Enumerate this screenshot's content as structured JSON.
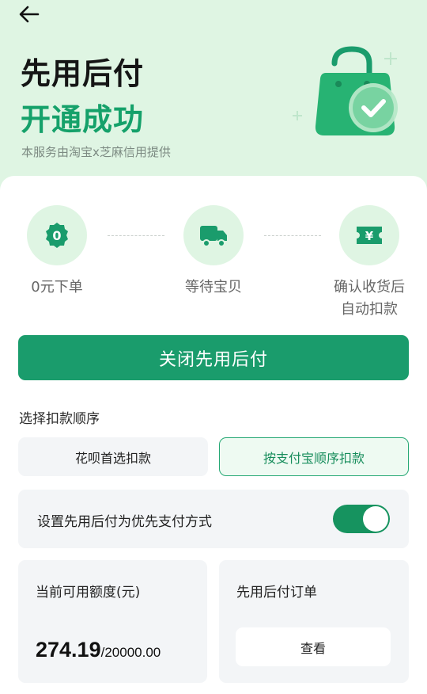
{
  "header": {
    "back_icon": "arrow-left-icon",
    "title": "先用后付",
    "subtitle": "开通成功",
    "note": "本服务由淘宝x芝麻信用提供",
    "illustration_icon": "shopping-bag-check-icon"
  },
  "steps": [
    {
      "icon": "zero-badge-icon",
      "icon_text": "0",
      "label": "0元下单"
    },
    {
      "icon": "truck-icon",
      "label": "等待宝贝"
    },
    {
      "icon": "yuan-ticket-icon",
      "icon_text": "¥",
      "label_line1": "确认收货后",
      "label_line2": "自动扣款"
    }
  ],
  "actions": {
    "close_label": "关闭先用后付"
  },
  "deduction": {
    "section_label": "选择扣款顺序",
    "options": [
      {
        "label": "花呗首选扣款",
        "selected": false
      },
      {
        "label": "按支付宝顺序扣款",
        "selected": true
      }
    ]
  },
  "preference": {
    "label": "设置先用后付为优先支付方式",
    "enabled": true
  },
  "credit": {
    "title": "当前可用额度(元)",
    "available": "274.19",
    "separator": "/",
    "total": "20000.00"
  },
  "orders": {
    "title": "先用后付订单",
    "view_label": "查看"
  },
  "colors": {
    "accent": "#1a9c6c",
    "hero_bg": "#dff5e3",
    "subtitle_green": "#15a16a"
  }
}
